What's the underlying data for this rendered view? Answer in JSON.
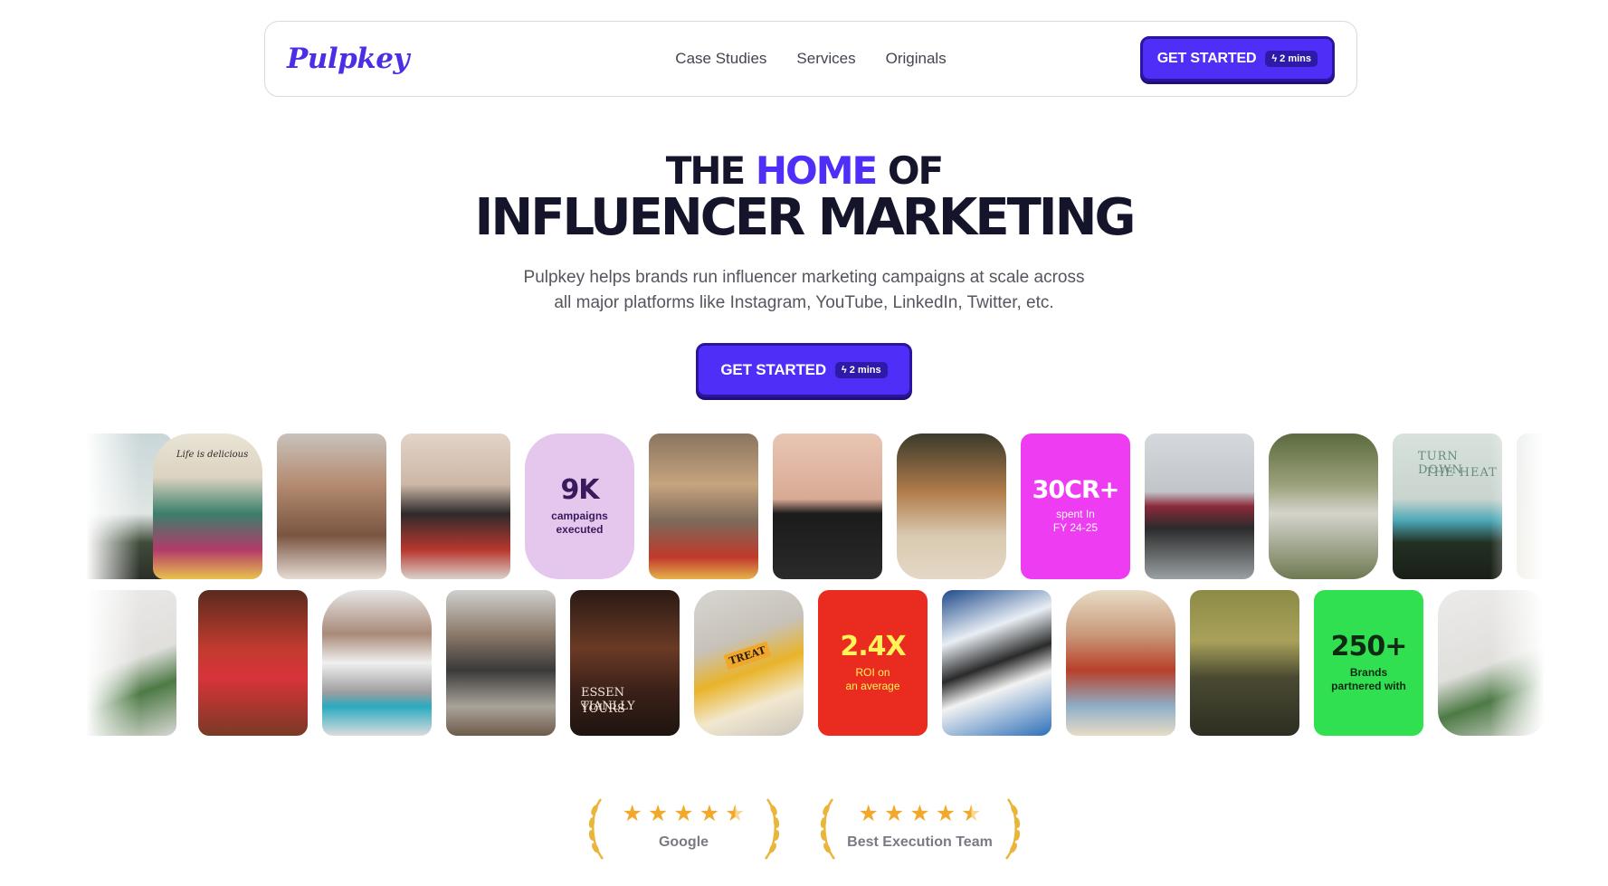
{
  "nav": {
    "logo": "Pulpkey",
    "links": [
      "Case Studies",
      "Services",
      "Originals"
    ],
    "cta_label": "GET STARTED",
    "cta_badge": "2 mins"
  },
  "hero": {
    "line1_pre": "THE",
    "line1_accent": "HOME",
    "line1_post": "OF",
    "line2": "INFLUENCER MARKETING",
    "sub_line1": "Pulpkey helps brands run influencer marketing campaigns at scale across",
    "sub_line2": "all major platforms like Instagram, YouTube, LinkedIn, Twitter, etc.",
    "cta_label": "GET STARTED",
    "cta_badge": "2 mins"
  },
  "stats": {
    "campaigns": {
      "value": "9K",
      "caption1": "campaigns",
      "caption2": "executed"
    },
    "spent": {
      "value": "30CR+",
      "caption1": "spent In",
      "caption2": "FY 24-25"
    },
    "roi": {
      "value": "2.4X",
      "caption1": "ROI on",
      "caption2": "an average"
    },
    "brands": {
      "value": "250+",
      "caption1": "Brands",
      "caption2": "partnered with"
    }
  },
  "tile_texts": {
    "life_delicious": "Life is delicious",
    "turn_down": "TURN DOWN",
    "the_heat": "THE HEAT",
    "essentially": "ESSEN TIANLLY",
    "yours": "YOURS",
    "treat": "TREAT"
  },
  "ratings": [
    {
      "label": "Google",
      "stars": 4.5
    },
    {
      "label": "Best Execution Team",
      "stars": 4.5
    }
  ],
  "colors": {
    "brand": "#4f2ef7",
    "stat_campaigns_bg": "#e5c6ec",
    "stat_spent_bg": "#ee3cf2",
    "stat_roi_bg": "#ea2b1f",
    "stat_brands_bg": "#31e050",
    "star": "#f2a92b"
  }
}
